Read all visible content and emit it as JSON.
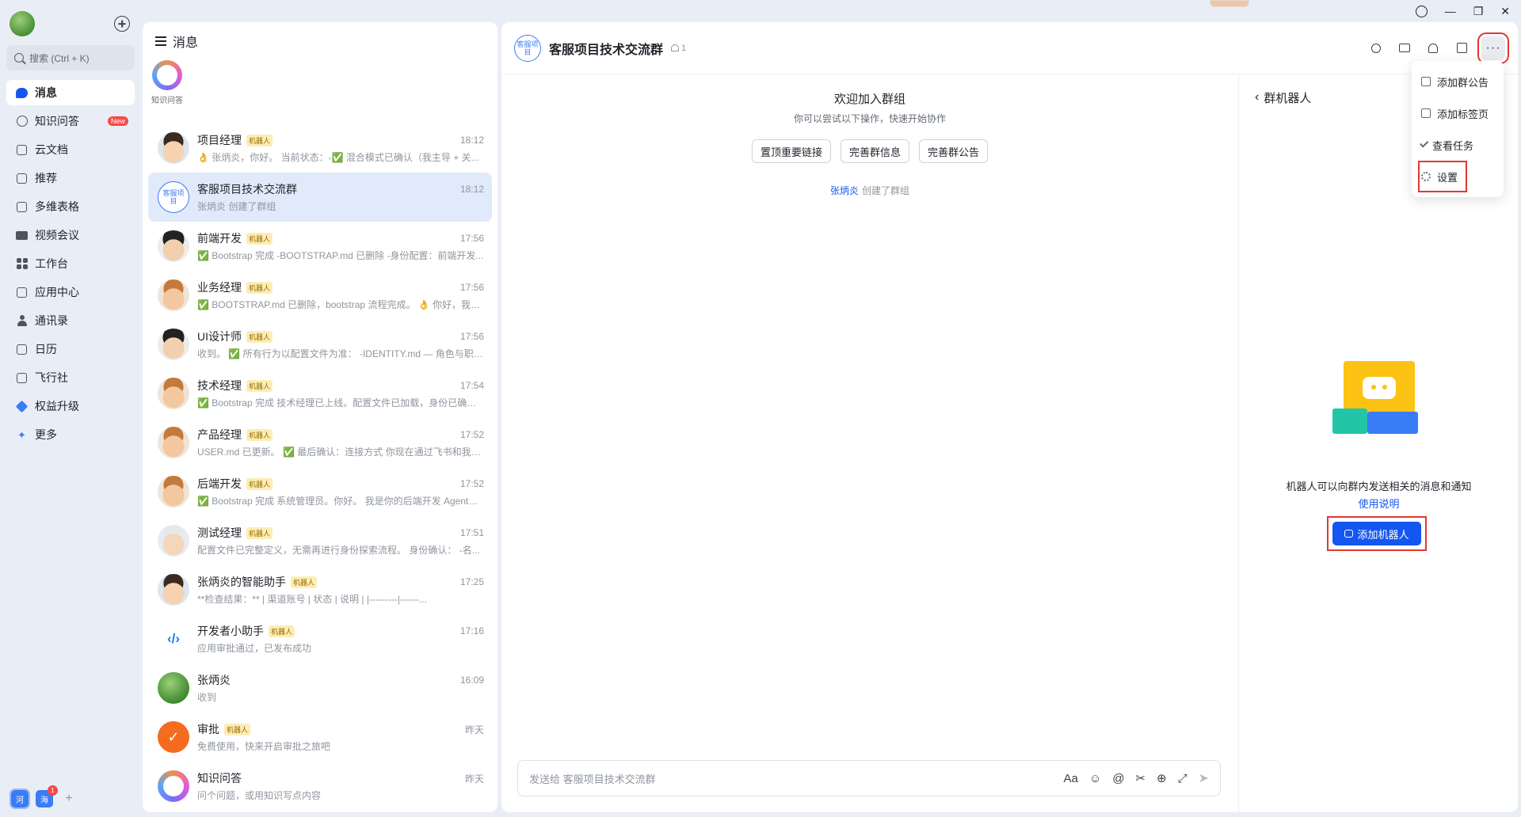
{
  "nav": {
    "search_placeholder": "搜索 (Ctrl + K)",
    "items": [
      {
        "label": "消息",
        "icon": "chat-icon",
        "active": true
      },
      {
        "label": "知识问答",
        "icon": "knowledge-icon",
        "badge": "New"
      },
      {
        "label": "云文档",
        "icon": "doc-icon"
      },
      {
        "label": "推荐",
        "icon": "recommend-icon"
      },
      {
        "label": "多维表格",
        "icon": "table-icon"
      },
      {
        "label": "视频会议",
        "icon": "video-icon"
      },
      {
        "label": "工作台",
        "icon": "grid-icon"
      },
      {
        "label": "应用中心",
        "icon": "app-center-icon"
      },
      {
        "label": "通讯录",
        "icon": "contacts-icon"
      },
      {
        "label": "日历",
        "icon": "calendar-icon"
      },
      {
        "label": "飞行社",
        "icon": "book-icon"
      },
      {
        "label": "权益升级",
        "icon": "diamond-icon"
      },
      {
        "label": "更多",
        "icon": "more-apps-icon"
      }
    ],
    "workspaces": [
      {
        "label": "河"
      },
      {
        "label": "海",
        "badge": "1"
      }
    ],
    "add_workspace": "+"
  },
  "list": {
    "title": "消息",
    "pinned": [
      {
        "label": "知识问答"
      }
    ],
    "chats": [
      {
        "name": "项目经理",
        "bot": true,
        "bot_tag": "机器人",
        "time": "18:12",
        "msg": "👌 张炳炎，你好。 当前状态：-✅ 混合模式已确认（我主导 + 关...",
        "avatar": "cartoon"
      },
      {
        "name": "客服项目技术交流群",
        "bot": false,
        "time": "18:12",
        "msg": "张炳炎 创建了群组",
        "avatar": "group",
        "avatar_text": "客服项目",
        "active": true
      },
      {
        "name": "前端开发",
        "bot": true,
        "bot_tag": "机器人",
        "time": "17:56",
        "msg": "✅ Bootstrap 完成 -BOOTSTRAP.md 已删除 -身份配置：前端开发...",
        "avatar": "cartoon4"
      },
      {
        "name": "业务经理",
        "bot": true,
        "bot_tag": "机器人",
        "time": "17:56",
        "msg": "✅ BOOTSTRAP.md 已删除，bootstrap 流程完成。 👌 你好，我是...",
        "avatar": "cartoon2"
      },
      {
        "name": "UI设计师",
        "bot": true,
        "bot_tag": "机器人",
        "time": "17:56",
        "msg": "收到。 ✅ 所有行为以配置文件为准： -IDENTITY.md — 角色与职责...",
        "avatar": "cartoon4"
      },
      {
        "name": "技术经理",
        "bot": true,
        "bot_tag": "机器人",
        "time": "17:54",
        "msg": "✅ Bootstrap 完成 技术经理已上线。配置文件已加载，身份已确认...",
        "avatar": "cartoon2"
      },
      {
        "name": "产品经理",
        "bot": true,
        "bot_tag": "机器人",
        "time": "17:52",
        "msg": "USER.md 已更新。 ✅ 最后确认：连接方式 你现在通过飞书和我对...",
        "avatar": "cartoon2"
      },
      {
        "name": "后端开发",
        "bot": true,
        "bot_tag": "机器人",
        "time": "17:52",
        "msg": "✅ Bootstrap 完成 系统管理员。你好。 我是你的后端开发 Agent。...",
        "avatar": "cartoon2"
      },
      {
        "name": "测试经理",
        "bot": true,
        "bot_tag": "机器人",
        "time": "17:51",
        "msg": "配置文件已完整定义，无需再进行身份探索流程。 身份确认： -名...",
        "avatar": "cartoon3"
      },
      {
        "name": "张炳炎的智能助手",
        "bot": true,
        "bot_tag": "机器人",
        "time": "17:25",
        "msg": "**检查结果：** | 渠道账号 | 状态 | 说明 | |---------|------...",
        "avatar": "cartoon"
      },
      {
        "name": "开发者小助手",
        "bot": true,
        "bot_tag": "机器人",
        "time": "17:16",
        "msg": "应用审批通过，已发布成功",
        "avatar": "dev",
        "avatar_text": "‹/›"
      },
      {
        "name": "张炳炎",
        "bot": false,
        "time": "16:09",
        "msg": "收到",
        "avatar": "green"
      },
      {
        "name": "审批",
        "bot": true,
        "bot_tag": "机器人",
        "time": "昨天",
        "msg": "免费使用，快来开启审批之旅吧",
        "avatar": "approve",
        "avatar_text": "✓"
      },
      {
        "name": "知识问答",
        "bot": false,
        "time": "昨天",
        "msg": "问个问题，或用知识写点内容",
        "avatar": "ring"
      }
    ]
  },
  "main": {
    "avatar_text": "客服项目",
    "title": "客服项目技术交流群",
    "member_count": "1",
    "more_label": "···",
    "welcome": {
      "title": "欢迎加入群组",
      "subtitle": "你可以尝试以下操作，快速开始协作",
      "buttons": [
        "置顶重要链接",
        "完善群信息",
        "完善群公告"
      ],
      "note_user": "张炳炎",
      "note_text": "创建了群组"
    },
    "composer": {
      "placeholder": "发送给 客服项目技术交流群",
      "tools": [
        "Aa",
        "☺",
        "@",
        "✂",
        "⊕",
        "⤢"
      ],
      "send": "➤"
    }
  },
  "bot_panel": {
    "back": "‹",
    "title": "群机器人",
    "description": "机器人可以向群内发送相关的消息和通知",
    "link": "使用说明",
    "add_button": "添加机器人"
  },
  "dropdown": {
    "items": [
      {
        "label": "添加群公告",
        "icon": "notice-icon"
      },
      {
        "label": "添加标签页",
        "icon": "tab-icon"
      },
      {
        "label": "查看任务",
        "icon": "task-icon"
      },
      {
        "label": "设置",
        "icon": "gear-icon",
        "highlight": true
      }
    ]
  },
  "window": {
    "minimize": "—",
    "restore": "❐",
    "close": "✕"
  },
  "colors": {
    "accent": "#1456f0",
    "highlight": "#e2382f",
    "bot_tag_bg": "#fcedb5"
  }
}
